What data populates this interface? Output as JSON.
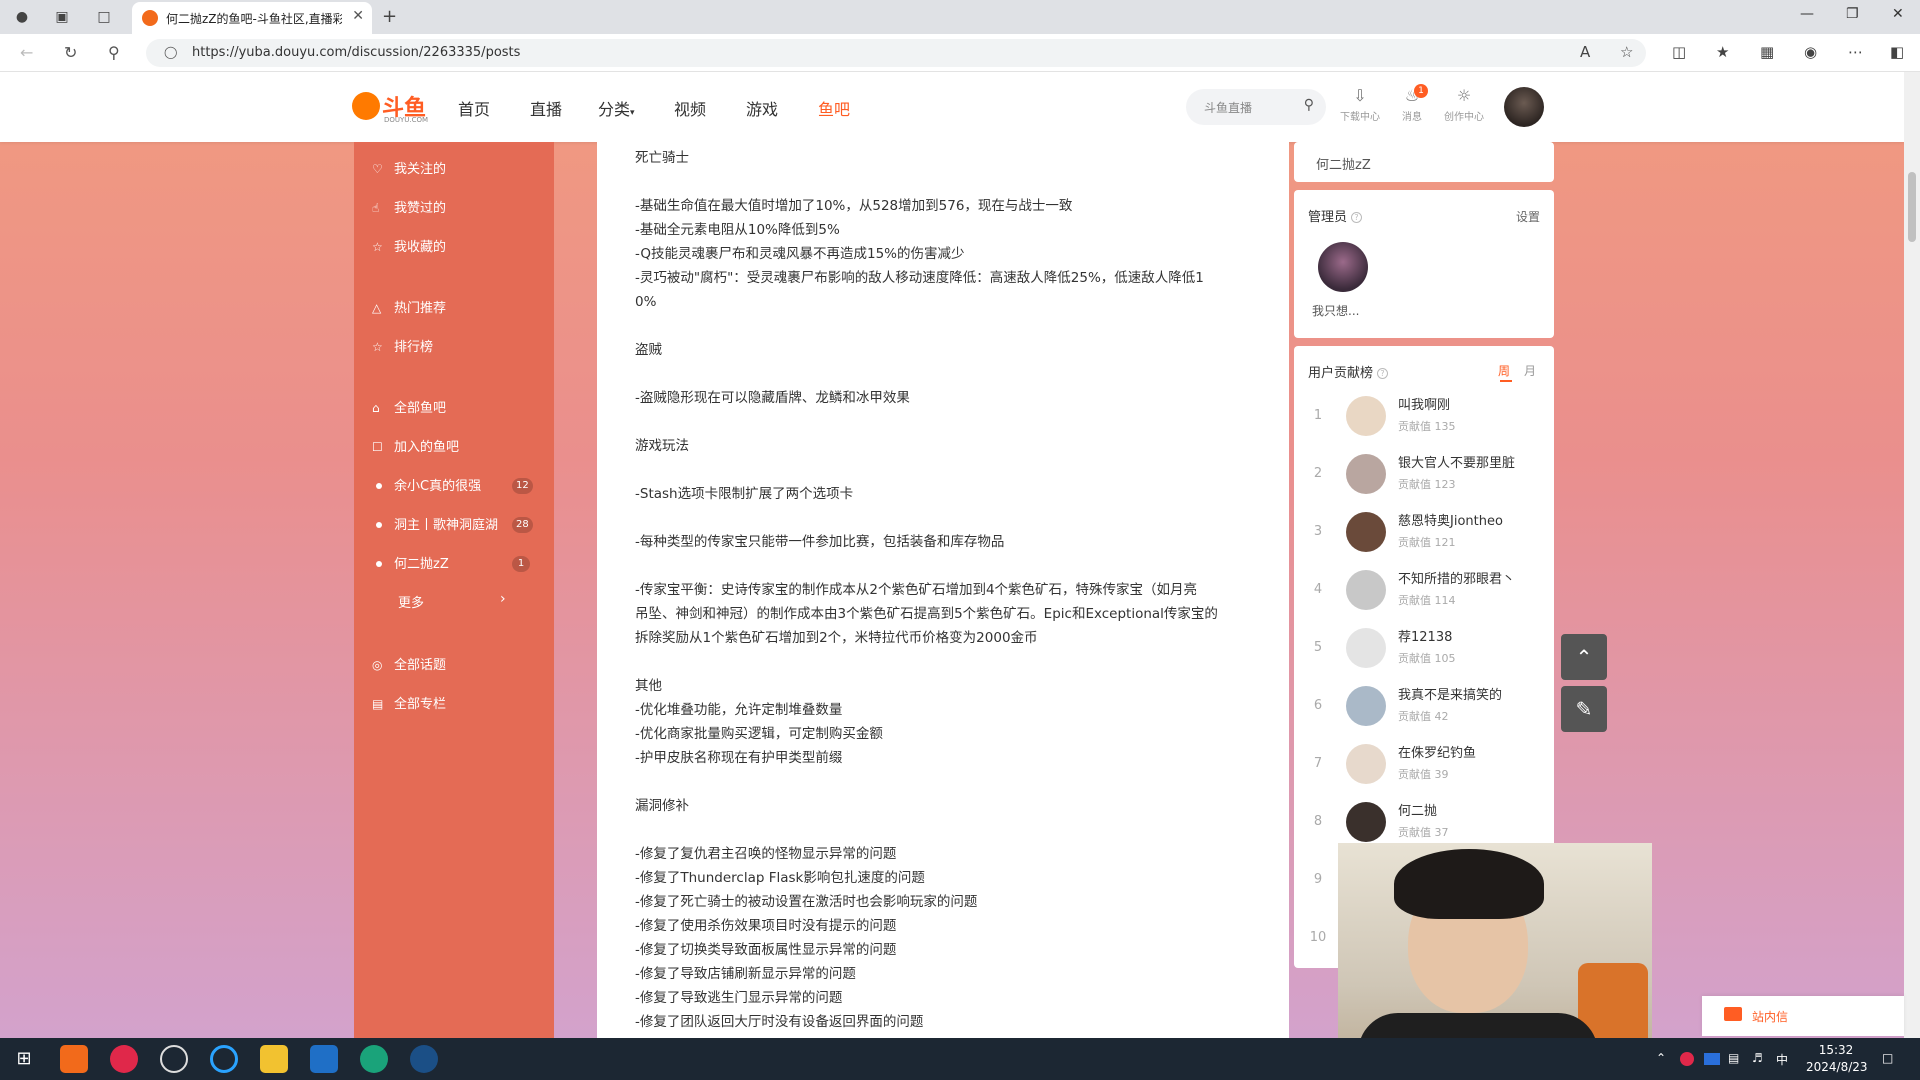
{
  "browser": {
    "tab_title": "何二抛zZ的鱼吧-斗鱼社区,直播彩",
    "url": "https://yuba.douyu.com/discussion/2263335/posts"
  },
  "header": {
    "logo_text": "斗鱼",
    "logo_sub": "DOUYU.COM",
    "nav": [
      "首页",
      "直播",
      "分类",
      "视频",
      "游戏",
      "鱼吧"
    ],
    "search_placeholder": "斗鱼直播",
    "tools": [
      {
        "label": "下载中心",
        "icon": "download-icon"
      },
      {
        "label": "消息",
        "icon": "bell-icon",
        "badge": "1"
      },
      {
        "label": "创作中心",
        "icon": "bulb-icon"
      }
    ]
  },
  "sidebar": {
    "items": [
      {
        "label": "我关注的",
        "icon": "heart-icon"
      },
      {
        "label": "我赞过的",
        "icon": "thumb-up-icon"
      },
      {
        "label": "我收藏的",
        "icon": "star-icon"
      },
      {
        "label": "热门推荐",
        "icon": "fire-icon"
      },
      {
        "label": "排行榜",
        "icon": "trophy-icon"
      },
      {
        "label": "全部鱼吧",
        "icon": "home-icon"
      },
      {
        "label": "加入的鱼吧",
        "icon": "shield-icon"
      }
    ],
    "joined": [
      {
        "label": "余小C真的很强",
        "count": "12"
      },
      {
        "label": "洞主丨歌神洞庭湖",
        "count": "28"
      },
      {
        "label": "何二抛zZ",
        "count": "1"
      }
    ],
    "more_label": "更多",
    "bottom_items": [
      {
        "label": "全部话题",
        "icon": "topic-icon"
      },
      {
        "label": "全部专栏",
        "icon": "column-icon"
      }
    ]
  },
  "post": {
    "lines": [
      "死亡骑士",
      "-基础生命值在最大值时增加了10%，从528增加到576，现在与战士一致",
      "-基础全元素电阻从10%降低到5%",
      "-Q技能灵魂裹尸布和灵魂风暴不再造成15%的伤害减少",
      "-灵巧被动\"腐朽\"：受灵魂裹尸布影响的敌人移动速度降低：高速敌人降低25%，低速敌人降低1",
      "0%",
      "盗贼",
      "-盗贼隐形现在可以隐藏盾牌、龙鳞和冰甲效果",
      "游戏玩法",
      "-Stash选项卡限制扩展了两个选项卡",
      "-每种类型的传家宝只能带一件参加比赛，包括装备和库存物品",
      "-传家宝平衡：史诗传家宝的制作成本从2个紫色矿石增加到4个紫色矿石，特殊传家宝（如月亮",
      "吊坠、神剑和神冠）的制作成本由3个紫色矿石提高到5个紫色矿石。Epic和Exceptional传家宝的",
      "拆除奖励从1个紫色矿石增加到2个，米特拉代币价格变为2000金币",
      "其他",
      "-优化堆叠功能，允许定制堆叠数量",
      "-优化商家批量购买逻辑，可定制购买金额",
      "-护甲皮肤名称现在有护甲类型前缀",
      "漏洞修补",
      "-修复了复仇君主召唤的怪物显示异常的问题",
      "-修复了Thunderclap Flask影响包扎速度的问题",
      "-修复了死亡骑士的被动设置在激活时也会影响玩家的问题",
      "-修复了使用杀伤效果项目时没有提示的问题",
      "-修复了切换类导致面板属性显示异常的问题",
      "-修复了导致店铺刷新显示异常的问题",
      "-修复了导致逃生门显示异常的问题",
      "-修复了团队返回大厅时没有设备返回界面的问题"
    ]
  },
  "right": {
    "owner_name": "何二抛zZ",
    "admin": {
      "title": "管理员",
      "settings": "设置",
      "name": "我只想..."
    },
    "rank": {
      "title": "用户贡献榜",
      "tab_week": "周",
      "tab_month": "月",
      "score_label": "贡献值",
      "rows": [
        {
          "rank": "1",
          "name": "叫我啊刚",
          "score": "135"
        },
        {
          "rank": "2",
          "name": "银大官人不要那里脏",
          "score": "123"
        },
        {
          "rank": "3",
          "name": "慈恩特奥Jiontheo",
          "score": "121"
        },
        {
          "rank": "4",
          "name": "不知所措的邪眼君丶",
          "score": "114"
        },
        {
          "rank": "5",
          "name": "荐12138",
          "score": "105"
        },
        {
          "rank": "6",
          "name": "我真不是来搞笑的",
          "score": "42"
        },
        {
          "rank": "7",
          "name": "在侏罗纪钓鱼",
          "score": "39"
        },
        {
          "rank": "8",
          "name": "何二抛",
          "score": "37"
        },
        {
          "rank": "9",
          "name": "",
          "score": ""
        },
        {
          "rank": "10",
          "name": "",
          "score": ""
        }
      ]
    }
  },
  "message_box": {
    "label": "站内信"
  },
  "taskbar": {
    "time": "15:32",
    "date": "2024/8/23",
    "ime": "中"
  },
  "colors": {
    "brand": "#ff5d23",
    "sidebar": "#e46b55",
    "taskbar": "#1c2733"
  }
}
